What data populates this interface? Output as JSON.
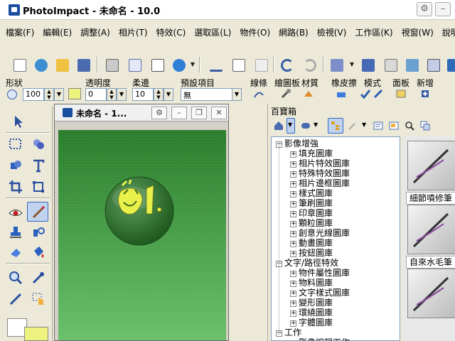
{
  "app": {
    "title": "PhotoImpact - 未命名 - 10.0"
  },
  "menu": {
    "items": [
      "檔案(F)",
      "編輯(E)",
      "調整(A)",
      "相片(T)",
      "特效(C)",
      "選取區(L)",
      "物件(O)",
      "網路(B)",
      "檢視(V)",
      "工作區(K)",
      "視窗(W)",
      "說明(H)"
    ]
  },
  "attributes": {
    "shape_label": "形狀",
    "size_value": "100",
    "transparency_label": "透明度",
    "transparency_value": "0",
    "soft_edge_label": "柔邊",
    "soft_edge_value": "10",
    "preset_label": "預設項目",
    "preset_value": "無",
    "line_label": "線條",
    "brush_palette_label": "繪圖板",
    "material_label": "材質",
    "eraser_label": "橡皮擦",
    "mode_label": "模式",
    "panel_label": "面板",
    "add_label": "新增"
  },
  "document": {
    "title": "未命名 - 1...",
    "canvas_colors": {
      "top": "#2a7d2a",
      "bottom": "#6ac06a",
      "sphere": "#3f7d3f",
      "face": "#e8f04a"
    }
  },
  "easypalette": {
    "title": "百寶箱",
    "tree": [
      {
        "label": "影像增強",
        "level": 0,
        "expanded": true
      },
      {
        "label": "填充圖庫",
        "level": 1,
        "expanded": false
      },
      {
        "label": "相片特效圖庫",
        "level": 1,
        "expanded": false
      },
      {
        "label": "特殊特效圖庫",
        "level": 1,
        "expanded": false
      },
      {
        "label": "相片邊框圖庫",
        "level": 1,
        "expanded": false
      },
      {
        "label": "樣式圖庫",
        "level": 1,
        "expanded": false
      },
      {
        "label": "筆刷圖庫",
        "level": 1,
        "expanded": false
      },
      {
        "label": "印章圖庫",
        "level": 1,
        "expanded": false
      },
      {
        "label": "顆粒圖庫",
        "level": 1,
        "expanded": false
      },
      {
        "label": "創意光線圖庫",
        "level": 1,
        "expanded": false
      },
      {
        "label": "動畫圖庫",
        "level": 1,
        "expanded": false
      },
      {
        "label": "按鈕圖庫",
        "level": 1,
        "expanded": false
      },
      {
        "label": "文字/路徑特效",
        "level": 0,
        "expanded": true
      },
      {
        "label": "物件屬性圖庫",
        "level": 1,
        "expanded": false
      },
      {
        "label": "物料圖庫",
        "level": 1,
        "expanded": false
      },
      {
        "label": "文字樣式圖庫",
        "level": 1,
        "expanded": false
      },
      {
        "label": "變形圖庫",
        "level": 1,
        "expanded": false
      },
      {
        "label": "環繞圖庫",
        "level": 1,
        "expanded": false
      },
      {
        "label": "字體圖庫",
        "level": 1,
        "expanded": false
      },
      {
        "label": "工作",
        "level": 0,
        "expanded": true
      },
      {
        "label": "影像編輯工作",
        "level": 1,
        "expanded": false
      }
    ],
    "gallery": [
      {
        "label": "細節噴修筆"
      },
      {
        "label": "自來水毛筆"
      },
      {
        "label": ""
      }
    ]
  },
  "colors": {
    "accent": "#316ac5",
    "face": "#ece9d8",
    "foreground_swatch": "#ffffff",
    "background_swatch": "#eef27e"
  }
}
